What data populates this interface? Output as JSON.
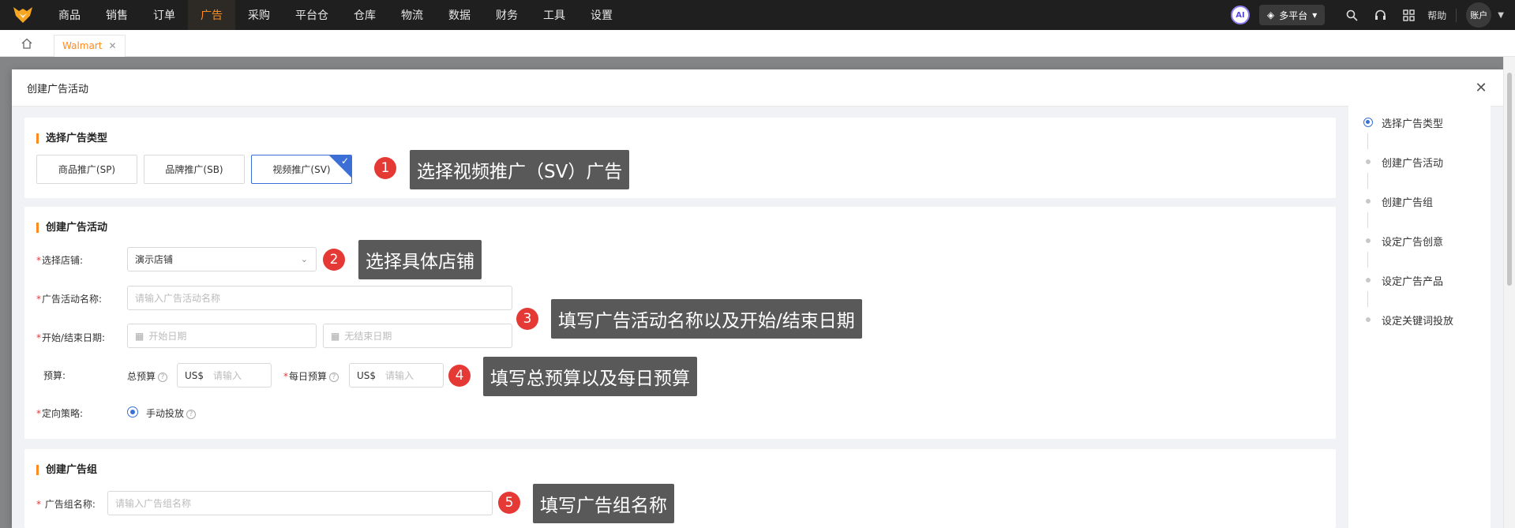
{
  "topnav": {
    "items": [
      "商品",
      "销售",
      "订单",
      "广告",
      "采购",
      "平台仓",
      "仓库",
      "物流",
      "数据",
      "财务",
      "工具",
      "设置"
    ],
    "active_index": 3,
    "ai_label": "AI",
    "platform_label": "多平台",
    "help_label": "帮助",
    "account_label": "账户"
  },
  "tabs": {
    "active_tab": "Walmart"
  },
  "modal": {
    "title": "创建广告活动",
    "section_type": {
      "title": "选择广告类型",
      "options": [
        "商品推广(SP)",
        "品牌推广(SB)",
        "视频推广(SV)"
      ],
      "selected_index": 2
    },
    "section_campaign": {
      "title": "创建广告活动",
      "store_label": "选择店铺:",
      "store_value": "演示店铺",
      "name_label": "广告活动名称:",
      "name_placeholder": "请输入广告活动名称",
      "date_label": "开始/结束日期:",
      "start_placeholder": "开始日期",
      "end_placeholder": "无结束日期",
      "budget_label": "预算:",
      "total_budget_label": "总预算",
      "daily_budget_label": "每日预算",
      "currency": "US$",
      "budget_placeholder": "请输入",
      "strategy_label": "定向策略:",
      "strategy_option": "手动投放"
    },
    "section_group": {
      "title": "创建广告组",
      "name_label": "广告组名称:",
      "name_placeholder": "请输入广告组名称"
    }
  },
  "annotations": [
    {
      "num": "1",
      "text": "选择视频推广（SV）广告"
    },
    {
      "num": "2",
      "text": "选择具体店铺"
    },
    {
      "num": "3",
      "text": "填写广告活动名称以及开始/结束日期"
    },
    {
      "num": "4",
      "text": "填写总预算以及每日预算"
    },
    {
      "num": "5",
      "text": "填写广告组名称"
    }
  ],
  "steps": [
    "选择广告类型",
    "创建广告活动",
    "创建广告组",
    "设定广告创意",
    "设定广告产品",
    "设定关键词投放"
  ],
  "colors": {
    "accent": "#ff8a1f",
    "primary": "#3b6fd6",
    "annotation_red": "#e53935",
    "callout_bg": "#595959"
  }
}
